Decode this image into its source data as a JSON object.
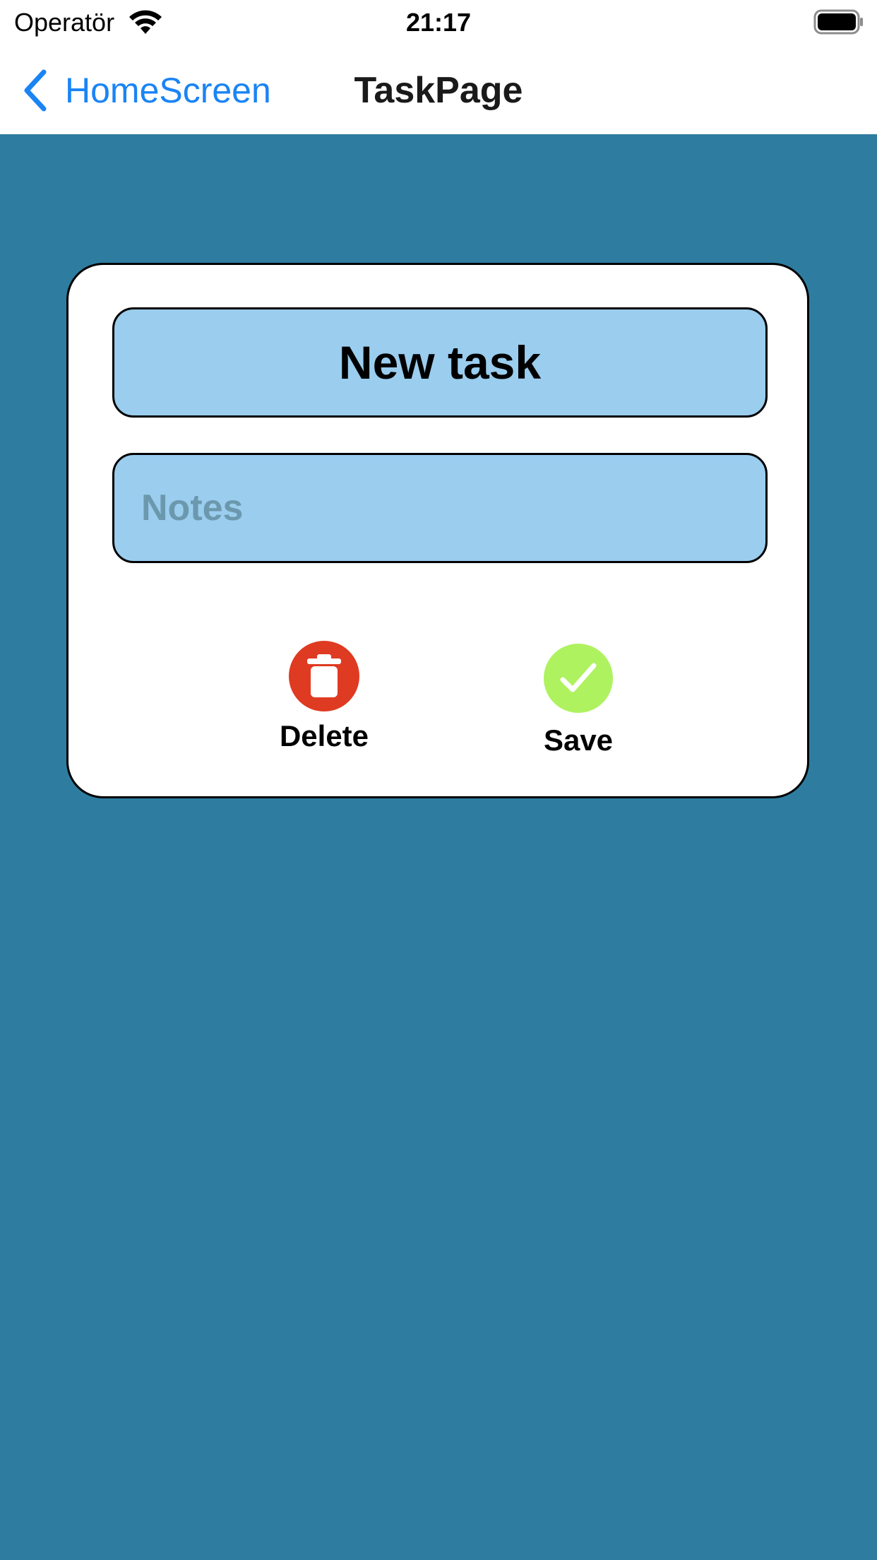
{
  "status_bar": {
    "carrier": "Operatör",
    "time": "21:17",
    "wifi_icon": "wifi-icon",
    "battery_icon": "battery-full-icon"
  },
  "nav": {
    "back_label": "HomeScreen",
    "back_icon": "chevron-left-icon",
    "title": "TaskPage"
  },
  "task_card": {
    "title_value": "New task",
    "notes_value": "",
    "notes_placeholder": "Notes",
    "delete_label": "Delete",
    "delete_icon": "trash-icon",
    "save_label": "Save",
    "save_icon": "checkmark-icon"
  },
  "colors": {
    "background": "#2e7da1",
    "field": "#9acdee",
    "back_link": "#1a84f5",
    "delete": "#df3a22",
    "save": "#aef25f"
  }
}
